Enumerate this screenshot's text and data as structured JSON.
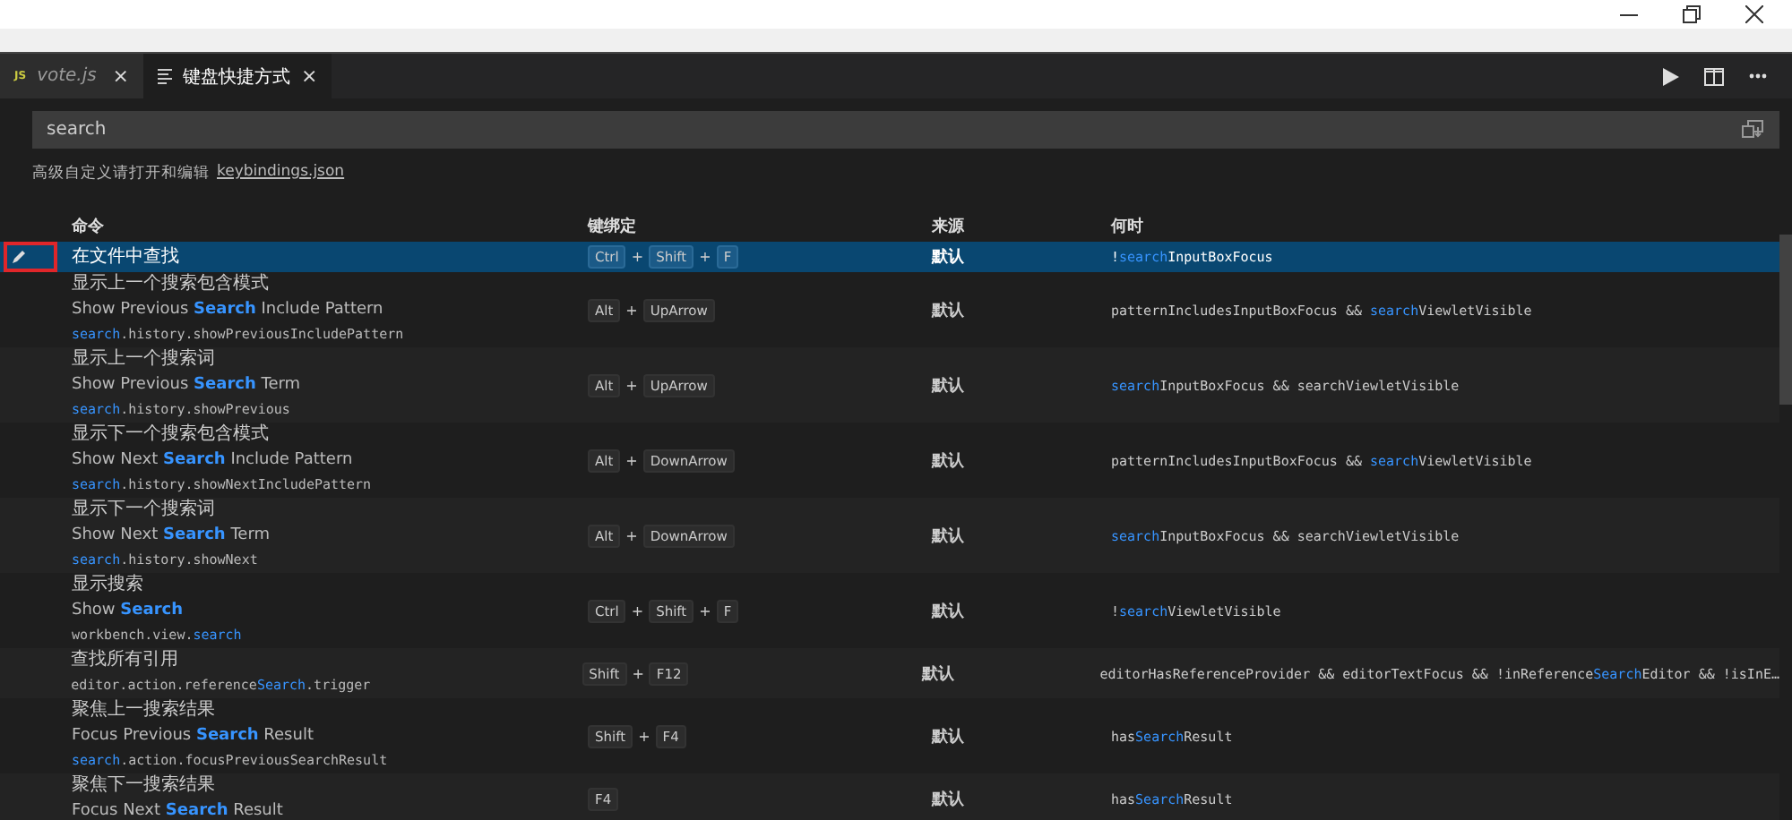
{
  "tabs": [
    {
      "icon_text": "JS",
      "label": "vote.js",
      "close": "×",
      "selected": false,
      "kind": "js"
    },
    {
      "label": "键盘快捷方式",
      "close": "×",
      "selected": true,
      "kind": "doc"
    }
  ],
  "search": {
    "value": "search"
  },
  "hint": {
    "text": "高级自定义请打开和编辑",
    "link": "keybindings.json"
  },
  "columns": [
    "命令",
    "键绑定",
    "来源",
    "何时"
  ],
  "rows": [
    {
      "selected": true,
      "annotated": true,
      "title": "在文件中查找",
      "label": [],
      "command": [],
      "keys": [
        {
          "kind": "key",
          "text": "Ctrl"
        },
        {
          "kind": "sep",
          "text": "+"
        },
        {
          "kind": "key",
          "text": "Shift"
        },
        {
          "kind": "sep",
          "text": "+"
        },
        {
          "kind": "key",
          "text": "F"
        }
      ],
      "source": "默认",
      "when": [
        {
          "text": "!"
        },
        {
          "text": "search",
          "match": true
        },
        {
          "text": "InputBoxFocus"
        }
      ]
    },
    {
      "selected": false,
      "title": "显示上一个搜索包含模式",
      "label": [
        {
          "text": "Show Previous "
        },
        {
          "text": "Search",
          "match": true
        },
        {
          "text": " Include Pattern"
        }
      ],
      "command": [
        {
          "text": "search",
          "match": true
        },
        {
          "text": ".history.showPreviousIncludePattern"
        }
      ],
      "keys": [
        {
          "kind": "key",
          "text": "Alt"
        },
        {
          "kind": "sep",
          "text": "+"
        },
        {
          "kind": "key",
          "text": "UpArrow"
        }
      ],
      "source": "默认",
      "when": [
        {
          "text": "patternIncludesInputBoxFocus && "
        },
        {
          "text": "search",
          "match": true
        },
        {
          "text": "ViewletVisible"
        }
      ]
    },
    {
      "selected": false,
      "title": "显示上一个搜索词",
      "label": [
        {
          "text": "Show Previous "
        },
        {
          "text": "Search",
          "match": true
        },
        {
          "text": " Term"
        }
      ],
      "command": [
        {
          "text": "search",
          "match": true
        },
        {
          "text": ".history.showPrevious"
        }
      ],
      "keys": [
        {
          "kind": "key",
          "text": "Alt"
        },
        {
          "kind": "sep",
          "text": "+"
        },
        {
          "kind": "key",
          "text": "UpArrow"
        }
      ],
      "source": "默认",
      "when": [
        {
          "text": "search",
          "match": true
        },
        {
          "text": "InputBoxFocus && searchViewletVisible"
        }
      ]
    },
    {
      "selected": false,
      "title": "显示下一个搜索包含模式",
      "label": [
        {
          "text": "Show Next "
        },
        {
          "text": "Search",
          "match": true
        },
        {
          "text": " Include Pattern"
        }
      ],
      "command": [
        {
          "text": "search",
          "match": true
        },
        {
          "text": ".history.showNextIncludePattern"
        }
      ],
      "keys": [
        {
          "kind": "key",
          "text": "Alt"
        },
        {
          "kind": "sep",
          "text": "+"
        },
        {
          "kind": "key",
          "text": "DownArrow"
        }
      ],
      "source": "默认",
      "when": [
        {
          "text": "patternIncludesInputBoxFocus && "
        },
        {
          "text": "search",
          "match": true
        },
        {
          "text": "ViewletVisible"
        }
      ]
    },
    {
      "selected": false,
      "title": "显示下一个搜索词",
      "label": [
        {
          "text": "Show Next "
        },
        {
          "text": "Search",
          "match": true
        },
        {
          "text": " Term"
        }
      ],
      "command": [
        {
          "text": "search",
          "match": true
        },
        {
          "text": ".history.showNext"
        }
      ],
      "keys": [
        {
          "kind": "key",
          "text": "Alt"
        },
        {
          "kind": "sep",
          "text": "+"
        },
        {
          "kind": "key",
          "text": "DownArrow"
        }
      ],
      "source": "默认",
      "when": [
        {
          "text": "search",
          "match": true
        },
        {
          "text": "InputBoxFocus && searchViewletVisible"
        }
      ]
    },
    {
      "selected": false,
      "title": "显示搜索",
      "label": [
        {
          "text": "Show "
        },
        {
          "text": "Search",
          "match": true
        }
      ],
      "command": [
        {
          "text": "workbench.view."
        },
        {
          "text": "search",
          "match": true
        }
      ],
      "keys": [
        {
          "kind": "key",
          "text": "Ctrl"
        },
        {
          "kind": "sep",
          "text": "+"
        },
        {
          "kind": "key",
          "text": "Shift"
        },
        {
          "kind": "sep",
          "text": "+"
        },
        {
          "kind": "key",
          "text": "F"
        }
      ],
      "source": "默认",
      "when": [
        {
          "text": "!"
        },
        {
          "text": "search",
          "match": true
        },
        {
          "text": "ViewletVisible"
        }
      ]
    },
    {
      "selected": false,
      "title": "查找所有引用",
      "label": [],
      "command": [
        {
          "text": "editor.action.reference"
        },
        {
          "text": "Search",
          "match": true
        },
        {
          "text": ".trigger"
        }
      ],
      "keys": [
        {
          "kind": "key",
          "text": "Shift"
        },
        {
          "kind": "sep",
          "text": "+"
        },
        {
          "kind": "key",
          "text": "F12"
        }
      ],
      "source": "默认",
      "when": [
        {
          "text": "editorHasReferenceProvider && editorTextFocus && !inReference"
        },
        {
          "text": "Search",
          "match": true
        },
        {
          "text": "Editor && !isInE…"
        }
      ]
    },
    {
      "selected": false,
      "title": "聚焦上一搜索结果",
      "label": [
        {
          "text": "Focus Previous "
        },
        {
          "text": "Search",
          "match": true
        },
        {
          "text": " Result"
        }
      ],
      "command": [
        {
          "text": "search",
          "match": true
        },
        {
          "text": ".action.focusPreviousSearchResult"
        }
      ],
      "keys": [
        {
          "kind": "key",
          "text": "Shift"
        },
        {
          "kind": "sep",
          "text": "+"
        },
        {
          "kind": "key",
          "text": "F4"
        }
      ],
      "source": "默认",
      "when": [
        {
          "text": "has"
        },
        {
          "text": "Search",
          "match": true
        },
        {
          "text": "Result"
        }
      ]
    },
    {
      "selected": false,
      "title": "聚焦下一搜索结果",
      "label": [
        {
          "text": "Focus Next "
        },
        {
          "text": "Search",
          "match": true
        },
        {
          "text": " Result"
        }
      ],
      "command": [],
      "keys": [
        {
          "kind": "key",
          "text": "F4"
        }
      ],
      "source": "默认",
      "when": [
        {
          "text": "has"
        },
        {
          "text": "Search",
          "match": true
        },
        {
          "text": "Result"
        }
      ]
    }
  ]
}
